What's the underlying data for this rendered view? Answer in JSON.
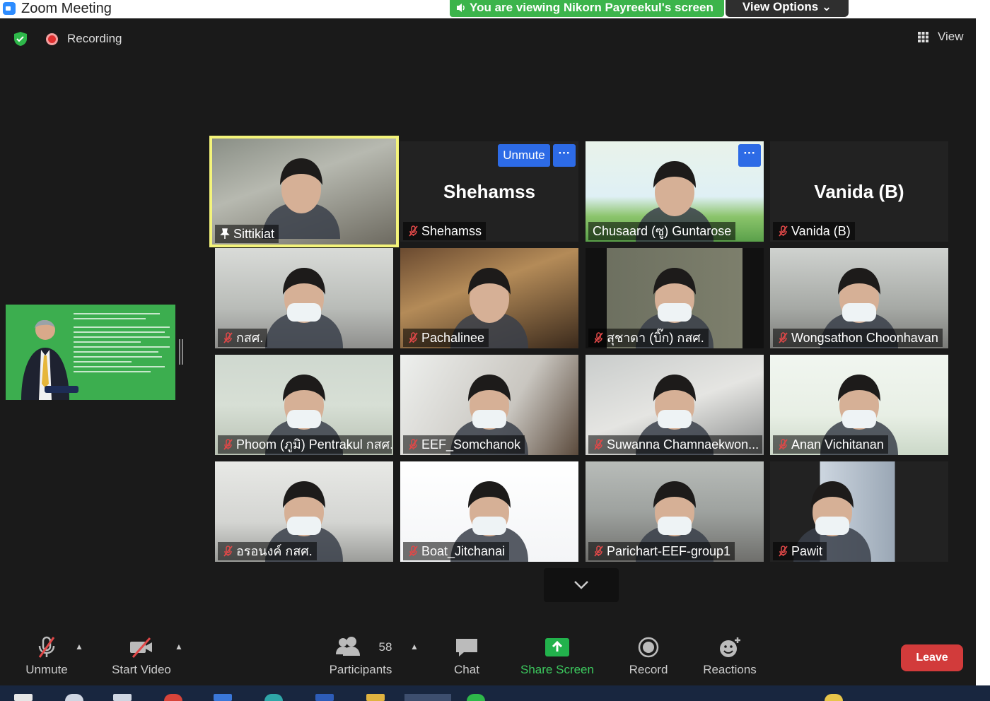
{
  "window": {
    "title": "Zoom Meeting"
  },
  "banner": {
    "sharing_text": "You are viewing Nikorn Payreekul's screen",
    "view_options_label": "View Options"
  },
  "top": {
    "recording_label": "Recording",
    "view_label": "View"
  },
  "tiles": [
    {
      "name": "Sittikiat",
      "muted": false,
      "active": true
    },
    {
      "name": "Shehamss",
      "big_name": "Shehamss",
      "muted": true,
      "unmute_label": "Unmute",
      "more_label": "···"
    },
    {
      "name": "Chusaard (ซู) Guntarose",
      "muted": false,
      "more_label": "···"
    },
    {
      "name": "Vanida (B)",
      "big_name": "Vanida (B)",
      "muted": true
    },
    {
      "name": "กสศ.",
      "muted": true
    },
    {
      "name": "Pachalinee",
      "muted": true
    },
    {
      "name": "สุชาดา (บิ๊ก) กสศ.",
      "muted": true
    },
    {
      "name": "Wongsathon Choonhavan",
      "muted": true
    },
    {
      "name": "Phoom (ภูมิ) Pentrakul กสศ.",
      "muted": true
    },
    {
      "name": "EEF_Somchanok",
      "muted": true
    },
    {
      "name": "Suwanna Chamnaekwon...",
      "muted": true
    },
    {
      "name": "Anan Vichitanan",
      "muted": true
    },
    {
      "name": "อรอนงค์ กสศ.",
      "muted": true
    },
    {
      "name": "Boat_Jitchanai",
      "muted": true
    },
    {
      "name": "Parichart-EEF-group1",
      "muted": true
    },
    {
      "name": "Pawit",
      "muted": true
    }
  ],
  "toolbar": {
    "unmute_label": "Unmute",
    "start_video_label": "Start Video",
    "participants_label": "Participants",
    "participants_count": "58",
    "chat_label": "Chat",
    "share_screen_label": "Share Screen",
    "record_label": "Record",
    "reactions_label": "Reactions",
    "leave_label": "Leave"
  },
  "colors": {
    "accent_blue": "#2d6be6",
    "share_green": "#3cb44b",
    "leave_red": "#d23b3b",
    "active_border": "#f4f47a"
  }
}
